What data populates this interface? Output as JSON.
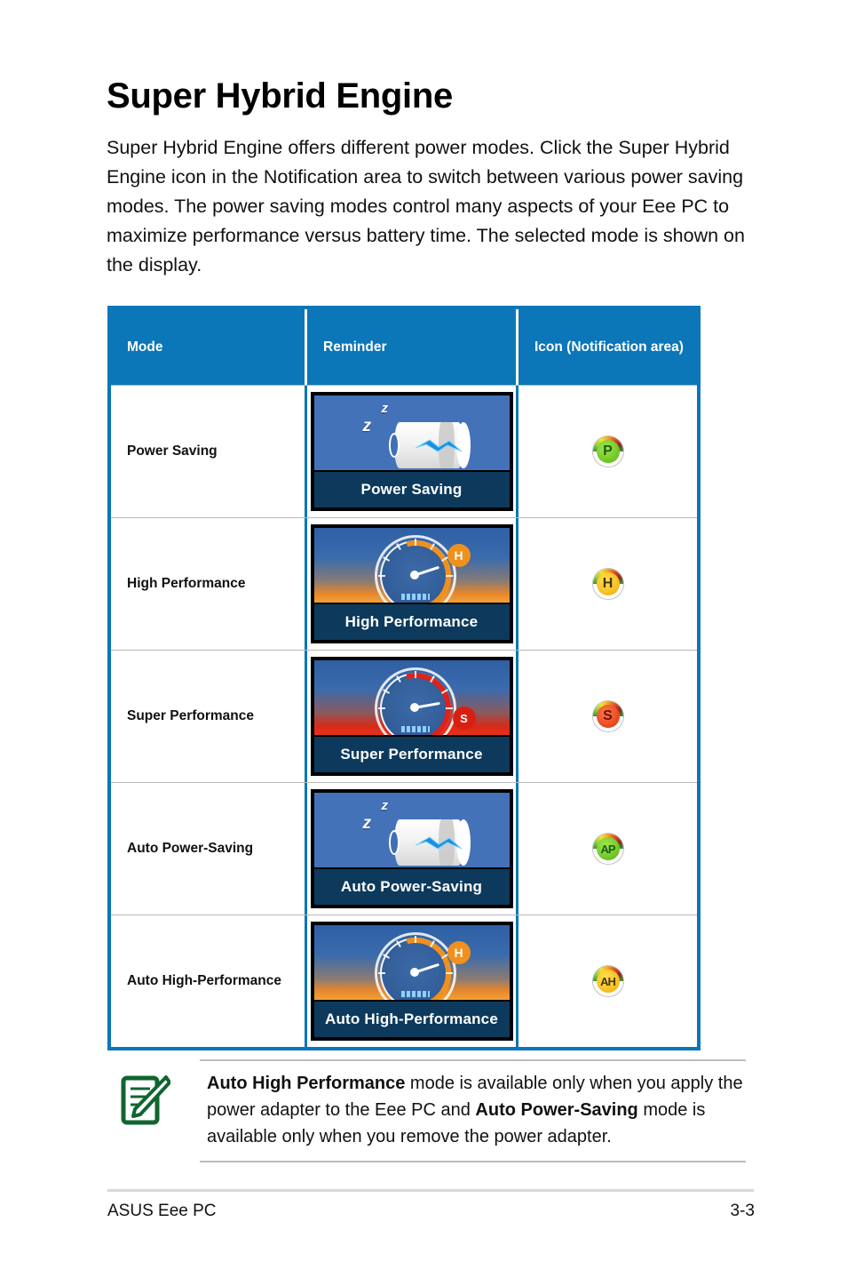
{
  "document": {
    "title": "Super Hybrid Engine",
    "intro": "Super Hybrid Engine offers different power modes. Click the Super Hybrid Engine icon in the Notification area to switch between various power saving modes. The power saving modes control many aspects of your Eee PC to maximize performance versus battery time. The selected mode is shown on the display."
  },
  "table": {
    "headers": [
      "Mode",
      "Reminder",
      "Icon (Notification area)"
    ],
    "header_bg": "#0b76b8",
    "border_color": "#0b76b8",
    "rows": [
      {
        "mode": "Power Saving",
        "reminder_label": "Power Saving",
        "reminder_art": "battery-sleep",
        "icon_name": "tray-icon-power-saving",
        "icon_glyph": "P",
        "icon_color": "#6cc423"
      },
      {
        "mode": "High Performance",
        "reminder_label": "High Performance",
        "reminder_art": "gauge-orange",
        "icon_name": "tray-icon-high-performance",
        "icon_glyph": "H",
        "icon_color": "#f5bb1e"
      },
      {
        "mode": "Super Performance",
        "reminder_label": "Super Performance",
        "reminder_art": "gauge-red",
        "icon_name": "tray-icon-super-performance",
        "icon_glyph": "S",
        "icon_color": "#e8441c"
      },
      {
        "mode": "Auto Power-Saving",
        "reminder_label": "Auto Power-Saving",
        "reminder_art": "battery-sleep",
        "icon_name": "tray-icon-auto-power-saving",
        "icon_glyph": "AP",
        "icon_color": "#6cc423"
      },
      {
        "mode": "Auto High-Performance",
        "reminder_label": "Auto High-Performance",
        "reminder_art": "gauge-orange",
        "icon_name": "tray-icon-auto-high-performance",
        "icon_glyph": "AH",
        "icon_color": "#f5bb1e"
      }
    ]
  },
  "note": {
    "icon": "note-pencil-icon",
    "icon_color": "#10652f",
    "text_part1_bold": "Auto High Performance",
    "text_part2": " mode is  available only when you apply the power adapter to the Eee PC and ",
    "text_part3_bold": "Auto Power-Saving",
    "text_part4": " mode is available only when you remove the power adapter."
  },
  "footer": {
    "left": "ASUS Eee PC",
    "right": "3-3"
  }
}
